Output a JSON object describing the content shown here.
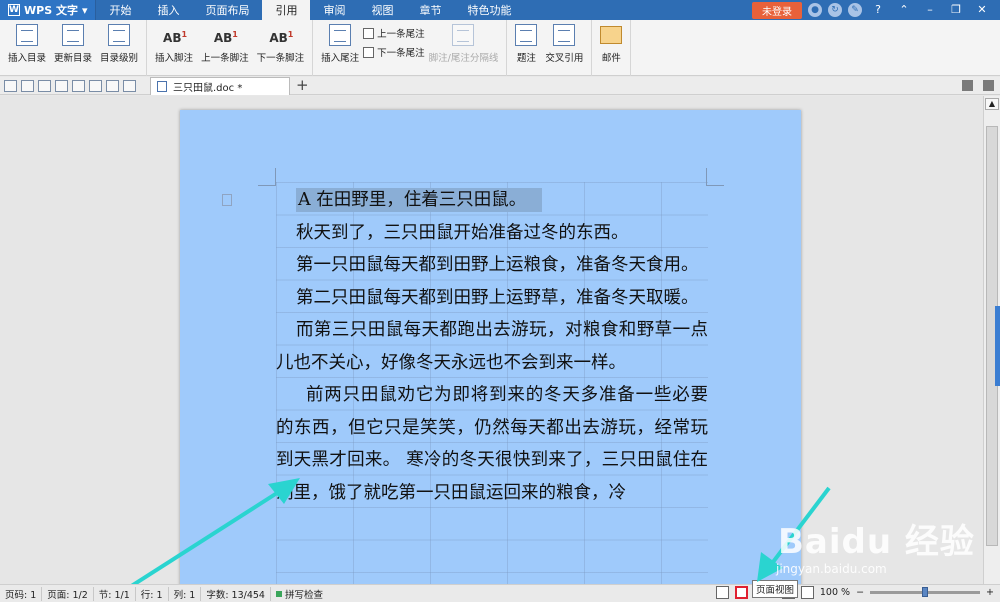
{
  "menubar": {
    "app_name": "WPS 文字",
    "tabs": [
      "开始",
      "插入",
      "页面布局",
      "引用",
      "审阅",
      "视图",
      "章节",
      "特色功能"
    ],
    "active_tab": "引用",
    "login_label": "未登录",
    "help_label": "?"
  },
  "ribbon": {
    "insert_toc": "插入目录",
    "update_toc": "更新目录",
    "toc_level": "目录级别",
    "insert_footnote": "插入脚注",
    "prev_footnote": "上一条脚注",
    "next_footnote": "下一条脚注",
    "insert_endnote": "插入尾注",
    "prev_endnote": "上一条尾注",
    "next_endnote": "下一条尾注",
    "separator_line": "脚注/尾注分隔线",
    "caption": "题注",
    "cross_ref": "交叉引用",
    "mail": "邮件"
  },
  "doc_tab": {
    "title": "三只田鼠.doc *"
  },
  "document": {
    "paragraphs": [
      "A 在田野里，住着三只田鼠。",
      "秋天到了，三只田鼠开始准备过冬的东西。",
      "第一只田鼠每天都到田野上运粮食，准备冬天食用。",
      "第二只田鼠每天都到田野上运野草，准备冬天取暖。",
      "而第三只田鼠每天都跑出去游玩，对粮食和野草一点儿也不关心，好像冬天永远也不会到来一样。",
      "前两只田鼠劝它为即将到来的冬天多准备一些必要的东西，但它只是笑笑，仍然每天都出去游玩，经常玩到天黑才回来。 寒冷的冬天很快到来了，三只田鼠住在洞里，饿了就吃第一只田鼠运回来的粮食，冷"
    ]
  },
  "statusbar": {
    "page_num": "页码: 1",
    "pages": "页面: 1/2",
    "section": "节: 1/1",
    "row": "行: 1",
    "col": "列: 1",
    "word_count": "字数: 13/454",
    "spell_check": "拼写检查",
    "zoom": "100 %",
    "zoom_level": 0.5,
    "tooltip": "页面视图"
  },
  "watermark": {
    "brand": "Baidu 经验",
    "url": "jingyan.baidu.com"
  },
  "colors": {
    "menu_bar": "#2e6db4",
    "page_background": "#9fcafb",
    "selection": "#8aaed6",
    "arrow": "#2ad4d0",
    "highlight_box": "#e02030"
  }
}
